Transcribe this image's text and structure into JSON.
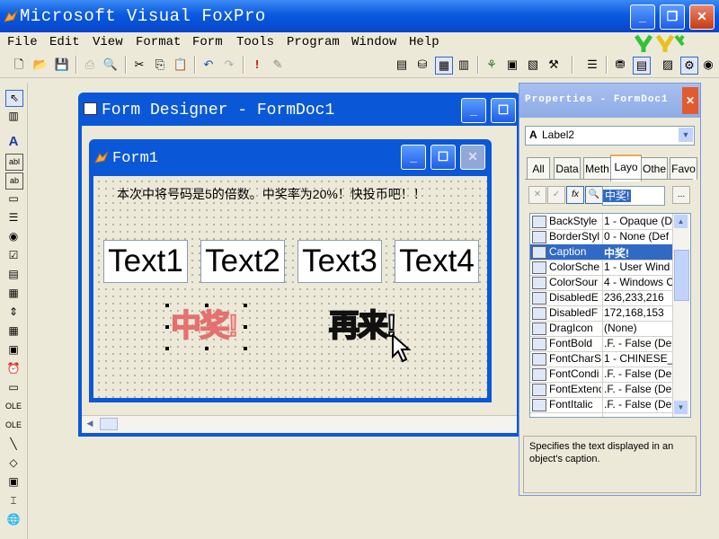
{
  "app": {
    "title": "Microsoft Visual FoxPro"
  },
  "menu": {
    "items": [
      {
        "key": "F",
        "rest": "ile"
      },
      {
        "key": "E",
        "rest": "dit"
      },
      {
        "key": "V",
        "rest": "iew"
      },
      {
        "key": "F",
        "rest": "ormat"
      },
      {
        "key": "Fo",
        "rest": "rm"
      },
      {
        "key": "T",
        "rest": "ools"
      },
      {
        "key": "P",
        "rest": "rogram"
      },
      {
        "key": "W",
        "rest": "indow"
      },
      {
        "key": "H",
        "rest": "elp"
      }
    ],
    "labels": [
      "File",
      "Edit",
      "View",
      "Format",
      "Form",
      "Tools",
      "Program",
      "Window",
      "Help"
    ]
  },
  "toolbar": {
    "icons": [
      "new-icon",
      "open-icon",
      "save-icon",
      "print-icon",
      "print-preview-icon",
      "cut-icon",
      "copy-icon",
      "paste-icon",
      "undo-icon",
      "redo-icon",
      "run-icon",
      "modify-icon",
      "combo",
      "command-window-icon",
      "data-session-icon",
      "form-designer-icon",
      "report-icon",
      "code-icon",
      "properties-icon",
      "view-icon",
      "build-icon",
      "layout-icon",
      "data-env-icon",
      "menu-icon",
      "toolbox-icon",
      "color-icon"
    ]
  },
  "form_designer": {
    "title": "Form Designer - FormDoc1"
  },
  "form1": {
    "title": "Form1",
    "label_top": "本次中将号码是5的倍数。中奖率为20%！快投币吧！！",
    "textboxes": [
      "Text1",
      "Text2",
      "Text3",
      "Text4"
    ],
    "label_win": "中奖!",
    "label_again": "再来!"
  },
  "properties": {
    "title": "Properties - FormDoc1",
    "object": "Label2",
    "tabs": [
      "All",
      "Data",
      "Meth",
      "Layo",
      "Othe",
      "Favo"
    ],
    "active_tab": "Layo",
    "caption_value": "中奖!",
    "rows": [
      {
        "name": "BackStyle",
        "value": "1 - Opaque (D"
      },
      {
        "name": "BorderStyl",
        "value": "0 - None (Def"
      },
      {
        "name": "Caption",
        "value": "中奖!"
      },
      {
        "name": "ColorSche",
        "value": "1 - User Wind"
      },
      {
        "name": "ColorSour",
        "value": "4 - Windows C"
      },
      {
        "name": "DisabledE",
        "value": "236,233,216"
      },
      {
        "name": "DisabledF",
        "value": "172,168,153"
      },
      {
        "name": "DragIcon",
        "value": "(None)"
      },
      {
        "name": "FontBold",
        "value": ".F. - False (De"
      },
      {
        "name": "FontCharS",
        "value": "1 - CHINESE_"
      },
      {
        "name": "FontCondi",
        "value": ".F. - False (De"
      },
      {
        "name": "FontExtenc",
        "value": ".F. - False (De"
      },
      {
        "name": "FontItalic",
        "value": ".F. - False (De"
      }
    ],
    "selected_row": 2,
    "description": "Specifies the text displayed in an object's caption."
  },
  "colors": {
    "title_blue": "#0a5ae0",
    "face": "#ECE9D8",
    "selection": "#316ac5"
  }
}
